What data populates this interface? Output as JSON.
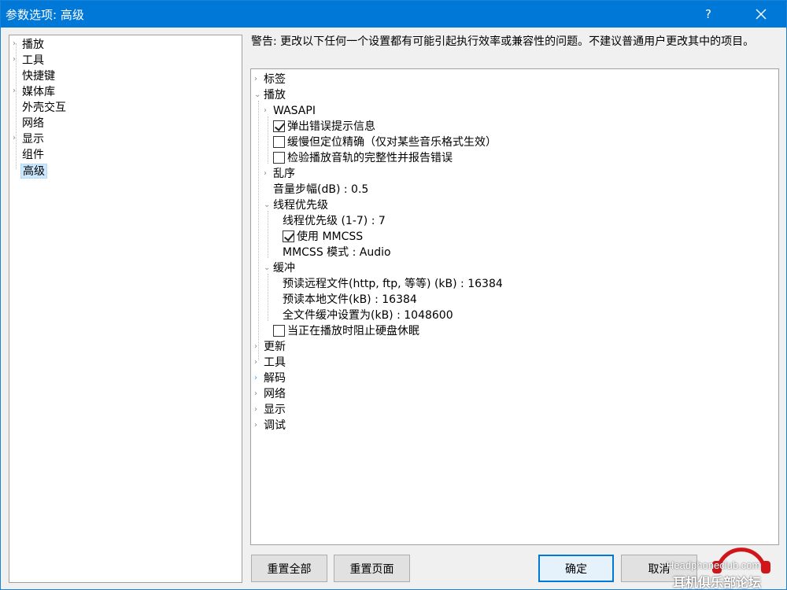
{
  "window": {
    "title": "参数选项: 高级",
    "help_label": "?"
  },
  "sidebar": {
    "items": [
      {
        "label": "播放",
        "expandable": true
      },
      {
        "label": "工具",
        "expandable": true
      },
      {
        "label": "快捷键",
        "expandable": false
      },
      {
        "label": "媒体库",
        "expandable": true
      },
      {
        "label": "外壳交互",
        "expandable": false
      },
      {
        "label": "网络",
        "expandable": false
      },
      {
        "label": "显示",
        "expandable": true
      },
      {
        "label": "组件",
        "expandable": false
      },
      {
        "label": "高级",
        "expandable": false,
        "selected": true
      }
    ]
  },
  "warning": "警告: 更改以下任何一个设置都有可能引起执行效率或兼容性的问题。不建议普通用户更改其中的项目。",
  "tree": {
    "tags": "标签",
    "playback": "播放",
    "wasapi": "WASAPI",
    "popup_errors": "弹出错误提示信息",
    "slow_seek": "缓慢但定位精确（仅对某些音乐格式生效）",
    "verify_tracks": "检验播放音轨的完整性并报告错误",
    "shuffle": "乱序",
    "volume_step": "音量步幅(dB) : 0.5",
    "thread_priority": "线程优先级",
    "thread_priority_value": "线程优先级 (1-7) : 7",
    "use_mmcss": "使用 MMCSS",
    "mmcss_mode": "MMCSS 模式 : Audio",
    "buffer": "缓冲",
    "prefetch_remote": "预读远程文件(http, ftp, 等等) (kB) : 16384",
    "prefetch_local": "预读本地文件(kB) : 16384",
    "full_buffer": "全文件缓冲设置为(kB) : 1048600",
    "prevent_sleep": "当正在播放时阻止硬盘休眠",
    "update": "更新",
    "tools": "工具",
    "decoding": "解码",
    "network": "网络",
    "display": "显示",
    "debug": "调试"
  },
  "checkboxes": {
    "popup_errors": true,
    "slow_seek": false,
    "verify_tracks": false,
    "use_mmcss": true,
    "prevent_sleep": false
  },
  "buttons": {
    "reset_all": "重置全部",
    "reset_page": "重置页面",
    "ok": "确定",
    "cancel": "取消"
  },
  "watermark": {
    "logo_text": "Headphoneclub.com",
    "cn_text": "耳机俱乐部论坛"
  },
  "colors": {
    "titlebar": "#0078d7",
    "selection": "#cce8ff",
    "accent_chevron": "#2c9cff"
  }
}
